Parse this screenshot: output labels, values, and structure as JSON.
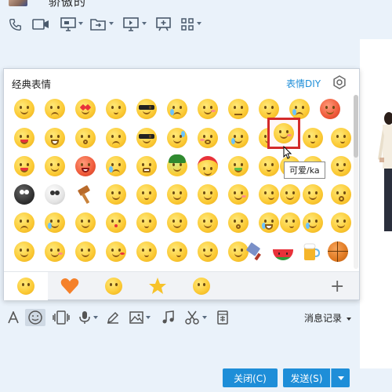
{
  "window": {
    "contact_name": "骄傲的",
    "bg_color": "#eaf2fa",
    "accent_color": "#1e8ed8"
  },
  "top_toolbar": {
    "icons": [
      "phone-icon",
      "video-icon",
      "screen-share-icon",
      "file-transfer-icon",
      "remote-desktop-icon",
      "whiteboard-icon",
      "apps-grid-icon"
    ]
  },
  "emoji_panel": {
    "title": "经典表情",
    "custom_link": "表情DIY",
    "tooltip": "可爱/ka",
    "selected_emoji": "可爱/ka",
    "categories": [
      "classic-face-tab",
      "heart-tab",
      "grin-tab",
      "star-tab",
      "laugh-tab"
    ]
  },
  "input_toolbar": {
    "icons": [
      "font-icon",
      "emoji-icon",
      "shake-icon",
      "voice-icon",
      "edit-icon",
      "image-icon",
      "music-icon",
      "screenshot-icon",
      "red-packet-icon"
    ],
    "message_record": "消息记录"
  },
  "buttons": {
    "close": "关闭(C)",
    "send": "发送(S)"
  }
}
